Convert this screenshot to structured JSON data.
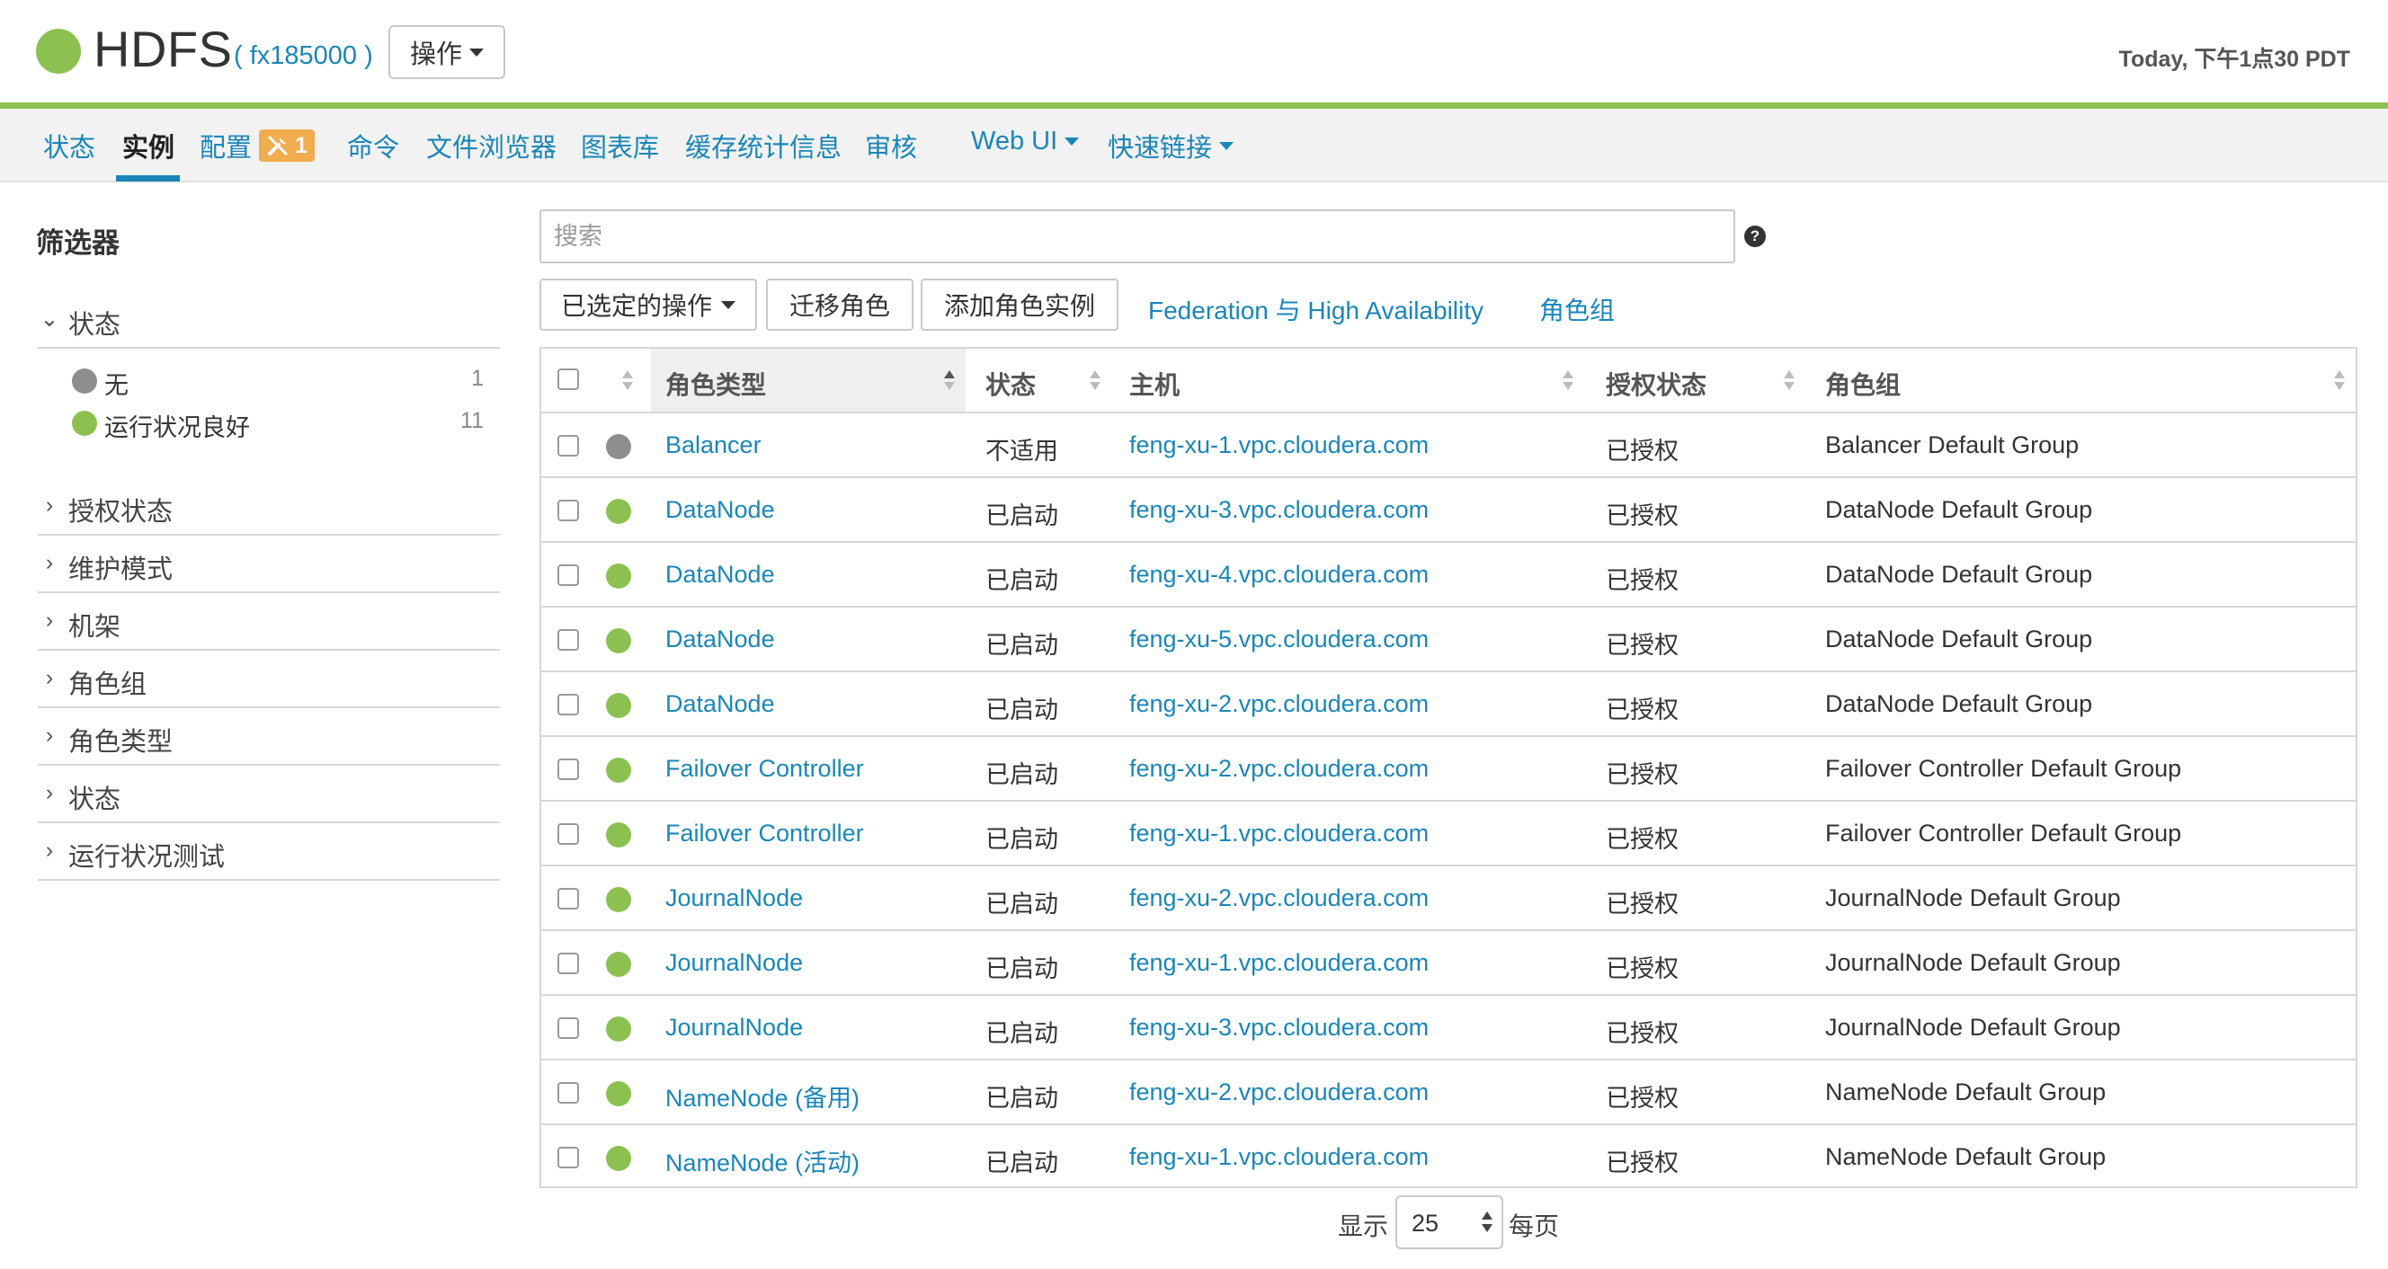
{
  "header": {
    "service_name": "HDFS",
    "cluster_name": "( fx185000 )",
    "actions_label": "操作",
    "time": "Today, 下午1点30 PDT",
    "status_color": "#8cc152"
  },
  "tabs": [
    {
      "label": "状态"
    },
    {
      "label": "实例",
      "active": true
    },
    {
      "label": "配置",
      "badge_count": "1"
    },
    {
      "label": "命令"
    },
    {
      "label": "文件浏览器"
    },
    {
      "label": "图表库"
    },
    {
      "label": "缓存统计信息"
    },
    {
      "label": "审核"
    },
    {
      "label": "Web UI"
    },
    {
      "label": "快速链接"
    }
  ],
  "sidebar": {
    "title": "筛选器",
    "sections": [
      {
        "label": "状态",
        "expanded": true,
        "options": [
          {
            "label": "无",
            "count": "1",
            "color": "#8e8e8e"
          },
          {
            "label": "运行状况良好",
            "count": "11",
            "color": "#8cc152"
          }
        ]
      },
      {
        "label": "授权状态"
      },
      {
        "label": "维护模式"
      },
      {
        "label": "机架"
      },
      {
        "label": "角色组"
      },
      {
        "label": "角色类型"
      },
      {
        "label": "状态"
      },
      {
        "label": "运行状况测试"
      }
    ]
  },
  "search": {
    "placeholder": "搜索",
    "value": ""
  },
  "toolbar": {
    "selected_actions": "已选定的操作",
    "migrate_roles": "迁移角色",
    "add_role_instances": "添加角色实例",
    "federation_link": "Federation 与 High Availability",
    "role_groups_link": "角色组"
  },
  "table": {
    "headers": {
      "role_type": "角色类型",
      "state": "状态",
      "host": "主机",
      "commission_state": "授权状态",
      "role_group": "角色组"
    },
    "sorted_column": "role_type",
    "rows": [
      {
        "health": "none",
        "role_type": "Balancer",
        "state": "不适用",
        "host": "feng-xu-1.vpc.cloudera.com",
        "commission": "已授权",
        "role_group": "Balancer Default Group"
      },
      {
        "health": "good",
        "role_type": "DataNode",
        "state": "已启动",
        "host": "feng-xu-3.vpc.cloudera.com",
        "commission": "已授权",
        "role_group": "DataNode Default Group"
      },
      {
        "health": "good",
        "role_type": "DataNode",
        "state": "已启动",
        "host": "feng-xu-4.vpc.cloudera.com",
        "commission": "已授权",
        "role_group": "DataNode Default Group"
      },
      {
        "health": "good",
        "role_type": "DataNode",
        "state": "已启动",
        "host": "feng-xu-5.vpc.cloudera.com",
        "commission": "已授权",
        "role_group": "DataNode Default Group"
      },
      {
        "health": "good",
        "role_type": "DataNode",
        "state": "已启动",
        "host": "feng-xu-2.vpc.cloudera.com",
        "commission": "已授权",
        "role_group": "DataNode Default Group"
      },
      {
        "health": "good",
        "role_type": "Failover Controller",
        "state": "已启动",
        "host": "feng-xu-2.vpc.cloudera.com",
        "commission": "已授权",
        "role_group": "Failover Controller Default Group"
      },
      {
        "health": "good",
        "role_type": "Failover Controller",
        "state": "已启动",
        "host": "feng-xu-1.vpc.cloudera.com",
        "commission": "已授权",
        "role_group": "Failover Controller Default Group"
      },
      {
        "health": "good",
        "role_type": "JournalNode",
        "state": "已启动",
        "host": "feng-xu-2.vpc.cloudera.com",
        "commission": "已授权",
        "role_group": "JournalNode Default Group"
      },
      {
        "health": "good",
        "role_type": "JournalNode",
        "state": "已启动",
        "host": "feng-xu-1.vpc.cloudera.com",
        "commission": "已授权",
        "role_group": "JournalNode Default Group"
      },
      {
        "health": "good",
        "role_type": "JournalNode",
        "state": "已启动",
        "host": "feng-xu-3.vpc.cloudera.com",
        "commission": "已授权",
        "role_group": "JournalNode Default Group"
      },
      {
        "health": "good",
        "role_type": "NameNode (备用)",
        "state": "已启动",
        "host": "feng-xu-2.vpc.cloudera.com",
        "commission": "已授权",
        "role_group": "NameNode Default Group"
      },
      {
        "health": "good",
        "role_type": "NameNode (活动)",
        "state": "已启动",
        "host": "feng-xu-1.vpc.cloudera.com",
        "commission": "已授权",
        "role_group": "NameNode Default Group"
      }
    ]
  },
  "health_colors": {
    "good": "#8cc152",
    "none": "#8e8e8e"
  },
  "pagination": {
    "show_label": "显示",
    "page_size": "25",
    "per_page_label": "每页"
  }
}
